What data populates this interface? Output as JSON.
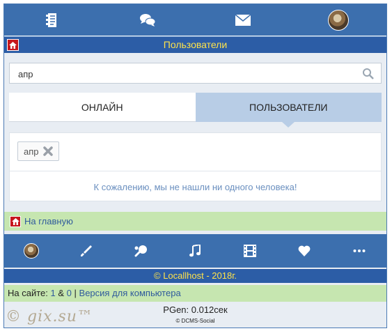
{
  "top_nav": {
    "items": [
      {
        "icon": "document-icon"
      },
      {
        "icon": "chat-icon"
      },
      {
        "icon": "mail-icon"
      },
      {
        "icon": "avatar"
      }
    ]
  },
  "title_bar": {
    "title": "Пользователи"
  },
  "search": {
    "value": "апр"
  },
  "tabs": [
    {
      "label": "ОНЛАЙН",
      "active": false
    },
    {
      "label": "ПОЛЬЗОВАТЕЛИ",
      "active": true
    }
  ],
  "results": {
    "filter_chip": "апр",
    "empty_message": "К сожалению, мы не нашли ни одного человека!"
  },
  "home_link": {
    "label": "На главную"
  },
  "bottom_nav": {
    "items": [
      "avatar",
      "brush-icon",
      "ping-pong-icon",
      "music-note-icon",
      "film-icon",
      "heart-icon",
      "more-icon"
    ]
  },
  "footer": {
    "copyright": "© Locallhost - 2018г.",
    "online_prefix": "На сайте:",
    "online_users": "1",
    "online_sep": "&",
    "online_guests": "0",
    "online_pipe": "|",
    "desktop_link": "Версия для компьютера",
    "pgen": "PGen: 0.012сек",
    "engine": "© DCMS-Social",
    "watermark": "© gix.su™"
  },
  "colors": {
    "nav_blue": "#3c6fae",
    "title_blue": "#2c5da6",
    "title_yellow": "#ffe34a",
    "green_bar": "#c6e6b0",
    "active_tab": "#b8cde6",
    "home_red": "#c6171d"
  }
}
